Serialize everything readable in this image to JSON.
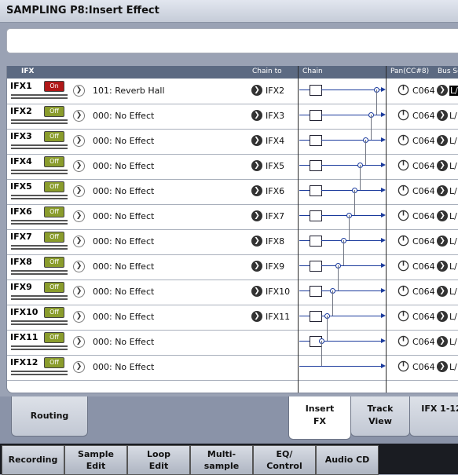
{
  "window": {
    "title": "SAMPLING P8:Insert Effect"
  },
  "name_field": {
    "value": ""
  },
  "table": {
    "headers": {
      "ifx": "IFX",
      "chain_to": "Chain to",
      "chain": "Chain",
      "pan": "Pan(CC#8)",
      "bus": "Bus Se"
    },
    "rows": [
      {
        "id": "IFX1",
        "switch": "On",
        "effect": "101: Reverb Hall",
        "chain_to": "IFX2",
        "pan": "C064",
        "bus": "L/"
      },
      {
        "id": "IFX2",
        "switch": "Off",
        "effect": "000: No Effect",
        "chain_to": "IFX3",
        "pan": "C064",
        "bus": "L/"
      },
      {
        "id": "IFX3",
        "switch": "Off",
        "effect": "000: No Effect",
        "chain_to": "IFX4",
        "pan": "C064",
        "bus": "L/"
      },
      {
        "id": "IFX4",
        "switch": "Off",
        "effect": "000: No Effect",
        "chain_to": "IFX5",
        "pan": "C064",
        "bus": "L/"
      },
      {
        "id": "IFX5",
        "switch": "Off",
        "effect": "000: No Effect",
        "chain_to": "IFX6",
        "pan": "C064",
        "bus": "L/"
      },
      {
        "id": "IFX6",
        "switch": "Off",
        "effect": "000: No Effect",
        "chain_to": "IFX7",
        "pan": "C064",
        "bus": "L/"
      },
      {
        "id": "IFX7",
        "switch": "Off",
        "effect": "000: No Effect",
        "chain_to": "IFX8",
        "pan": "C064",
        "bus": "L/"
      },
      {
        "id": "IFX8",
        "switch": "Off",
        "effect": "000: No Effect",
        "chain_to": "IFX9",
        "pan": "C064",
        "bus": "L/"
      },
      {
        "id": "IFX9",
        "switch": "Off",
        "effect": "000: No Effect",
        "chain_to": "IFX10",
        "pan": "C064",
        "bus": "L/"
      },
      {
        "id": "IFX10",
        "switch": "Off",
        "effect": "000: No Effect",
        "chain_to": "IFX11",
        "pan": "C064",
        "bus": "L/"
      },
      {
        "id": "IFX11",
        "switch": "Off",
        "effect": "000: No Effect",
        "chain_to": "",
        "pan": "C064",
        "bus": "L/"
      },
      {
        "id": "IFX12",
        "switch": "Off",
        "effect": "000: No Effect",
        "chain_to": "",
        "pan": "C064",
        "bus": "L/"
      }
    ]
  },
  "page_tabs": [
    {
      "label": "Routing",
      "active": false
    },
    {
      "label": "Insert FX",
      "active": true
    },
    {
      "label": "Track View",
      "active": false
    },
    {
      "label": "IFX 1-12",
      "active": false
    }
  ],
  "mode_tabs": [
    "Recording",
    "Sample Edit",
    "Loop Edit",
    "Multi- sample",
    "EQ/ Control",
    "Audio CD"
  ],
  "colors": {
    "switch_on": "#b01818",
    "switch_off": "#8a9c2c",
    "chain_line": "#1a3a9c",
    "header": "#5c6a82"
  },
  "icons": {
    "select_arrow": "chevron-right-circle-icon",
    "pan_knob": "knob-icon"
  }
}
